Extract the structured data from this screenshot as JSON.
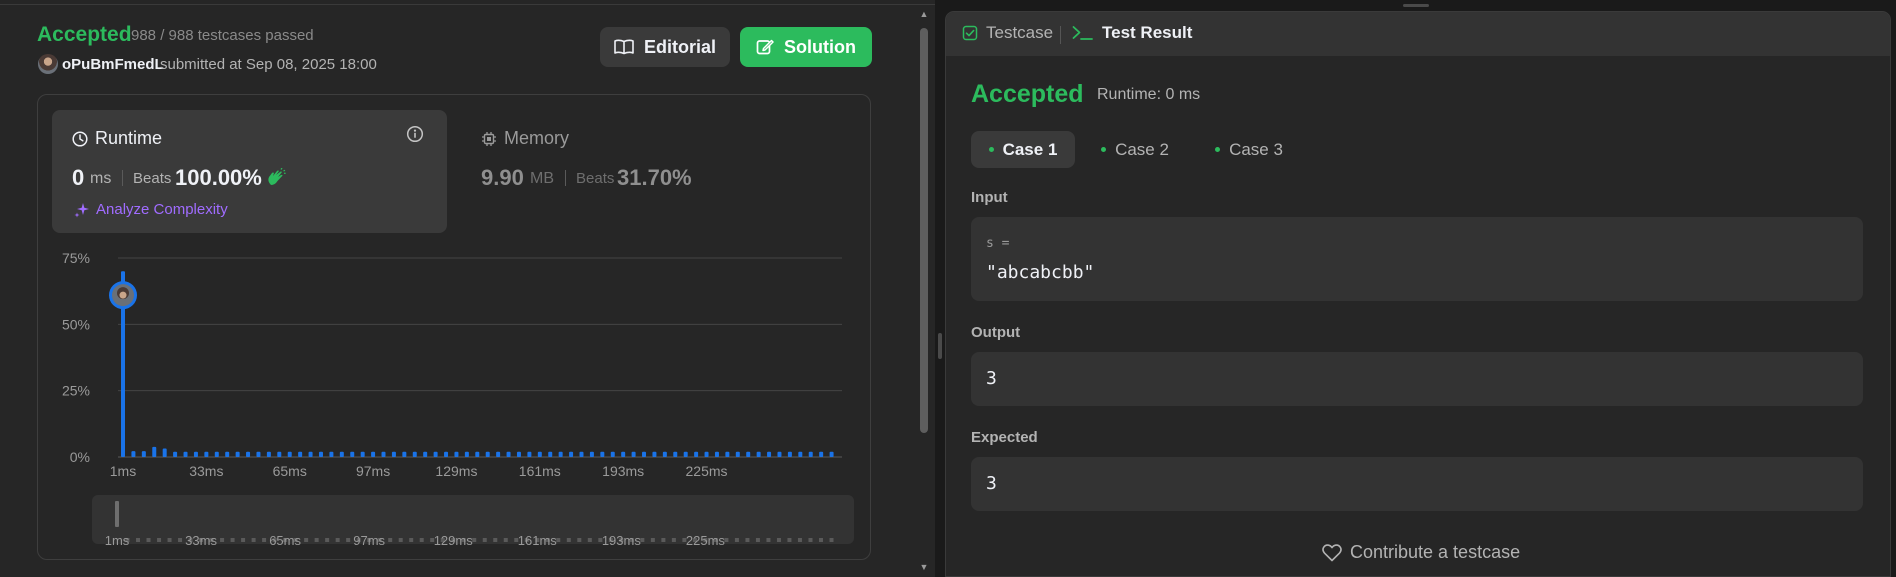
{
  "left": {
    "status": "Accepted",
    "testcases": "988 / 988 testcases passed",
    "username": "oPuBmFmedL",
    "submitted": "submitted at Sep 08, 2025 18:00",
    "editorial_label": "Editorial",
    "solution_label": "Solution",
    "runtime": {
      "title": "Runtime",
      "value": "0",
      "unit": "ms",
      "beats_label": "Beats",
      "percent": "100.00%",
      "analyze_label": "Analyze Complexity"
    },
    "memory": {
      "title": "Memory",
      "value": "9.90",
      "unit": "MB",
      "beats_label": "Beats",
      "percent": "31.70%"
    }
  },
  "right": {
    "tab_testcase": "Testcase",
    "tab_result": "Test Result",
    "result_status": "Accepted",
    "runtime_text": "Runtime: 0 ms",
    "cases": [
      "Case 1",
      "Case 2",
      "Case 3"
    ],
    "active_case": 0,
    "input_label": "Input",
    "input_var": "s =",
    "input_value": "\"abcabcbb\"",
    "output_label": "Output",
    "output_value": "3",
    "expected_label": "Expected",
    "expected_value": "3",
    "contribute_label": "Contribute a testcase"
  },
  "colors": {
    "accent_green": "#2cbb5d",
    "bar_blue": "#1a73e8",
    "purple": "#a06cff",
    "bg": "#262626"
  },
  "chart_data": {
    "type": "bar",
    "title": "",
    "y_ticks": [
      "75%",
      "50%",
      "25%",
      "0%"
    ],
    "ylim": [
      0,
      75
    ],
    "x_ticks": [
      "1ms",
      "33ms",
      "65ms",
      "97ms",
      "129ms",
      "161ms",
      "193ms",
      "225ms"
    ],
    "minimap_ticks": [
      "1ms",
      "33ms",
      "65ms",
      "97ms",
      "129ms",
      "161ms",
      "193ms",
      "225ms"
    ],
    "x": [
      1,
      5,
      9,
      13,
      17,
      21,
      25,
      29,
      33,
      37,
      41,
      45,
      49,
      53,
      57,
      61,
      65,
      69,
      73,
      77,
      81,
      85,
      89,
      93,
      97,
      101,
      105,
      109,
      113,
      117,
      121,
      125,
      129,
      133,
      137,
      141,
      145,
      149,
      153,
      157,
      161,
      165,
      169,
      173,
      177,
      181,
      185,
      189,
      193,
      197,
      201,
      205,
      209,
      213,
      217,
      221,
      225,
      229,
      233,
      237,
      241,
      245,
      249,
      253,
      257,
      261,
      265,
      269,
      273
    ],
    "values": [
      70,
      2.2,
      2.2,
      3.8,
      3.2,
      2.0,
      2.0,
      2.0,
      2.0,
      2.0,
      2.0,
      2.0,
      2.0,
      2.0,
      2.0,
      2.0,
      2.0,
      2.0,
      2.0,
      2.0,
      2.0,
      2.0,
      2.0,
      2.0,
      2.0,
      2.0,
      2.0,
      2.0,
      2.0,
      2.0,
      2.0,
      2.0,
      2.0,
      2.0,
      2.0,
      2.0,
      2.0,
      2.0,
      2.0,
      2.0,
      2.0,
      2.0,
      2.0,
      2.0,
      2.0,
      2.0,
      2.0,
      2.0,
      2.0,
      2.0,
      2.0,
      2.0,
      2.0,
      2.0,
      2.0,
      2.0,
      2.0,
      2.0,
      2.0,
      2.0,
      2.0,
      2.0,
      2.0,
      2.0,
      2.0,
      2.0,
      2.0,
      2.0,
      2.0
    ],
    "user_marker_x": 1,
    "user_marker_value": 61
  }
}
